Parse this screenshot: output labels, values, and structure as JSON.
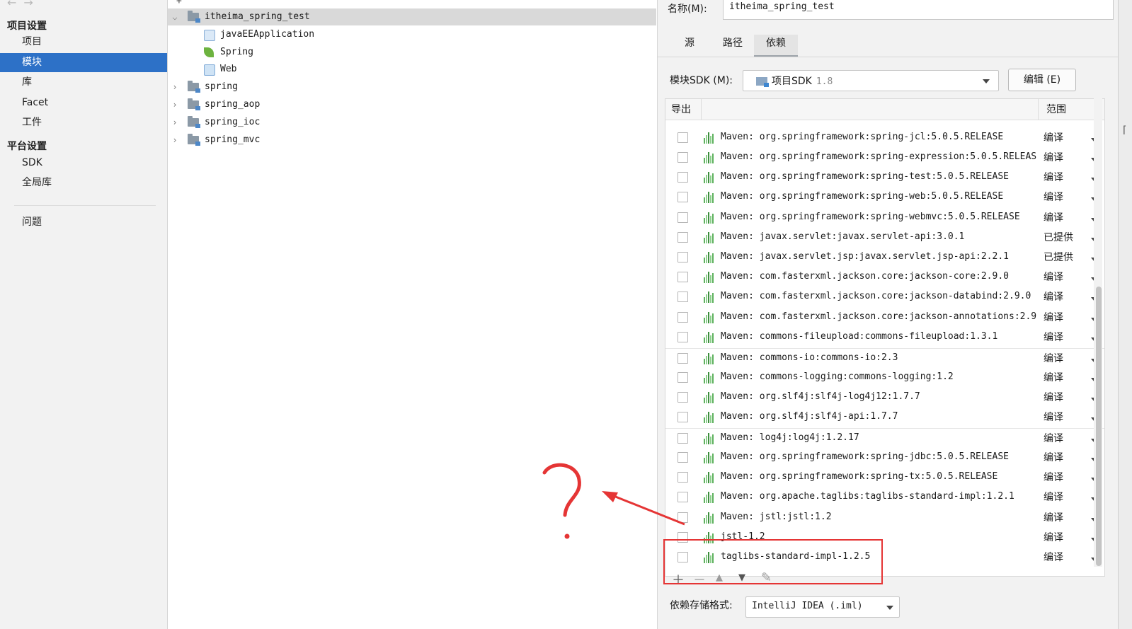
{
  "sidebar": {
    "project_settings_header": "项目设置",
    "items": [
      {
        "label": "项目"
      },
      {
        "label": "模块"
      },
      {
        "label": "库"
      },
      {
        "label": "Facet"
      },
      {
        "label": "工件"
      }
    ],
    "platform_settings_header": "平台设置",
    "platform_items": [
      {
        "label": "SDK"
      },
      {
        "label": "全局库"
      }
    ],
    "problems": "问题"
  },
  "tree": {
    "rows": [
      {
        "label": "itheima_spring_test"
      },
      {
        "label": "javaEEApplication"
      },
      {
        "label": "Spring"
      },
      {
        "label": "Web"
      },
      {
        "label": "spring"
      },
      {
        "label": "spring_aop"
      },
      {
        "label": "spring_ioc"
      },
      {
        "label": "spring_mvc"
      }
    ]
  },
  "module": {
    "name_label": "名称(M):",
    "name_value": "itheima_spring_test",
    "tabs": [
      {
        "label": "源"
      },
      {
        "label": "路径"
      },
      {
        "label": "依赖"
      }
    ],
    "sdk_label": "模块SDK (M):",
    "sdk_value": "项目SDK",
    "sdk_version": "1.8",
    "edit_button": "编辑 (E)",
    "table_header_export": "导出",
    "table_header_scope": "范围",
    "dependencies": [
      {
        "name": "Maven: org.springframework:spring-jcl:5.0.5.RELEASE",
        "scope": "编译"
      },
      {
        "name": "Maven: org.springframework:spring-expression:5.0.5.RELEAS",
        "scope": "编译"
      },
      {
        "name": "Maven: org.springframework:spring-test:5.0.5.RELEASE",
        "scope": "编译"
      },
      {
        "name": "Maven: org.springframework:spring-web:5.0.5.RELEASE",
        "scope": "编译"
      },
      {
        "name": "Maven: org.springframework:spring-webmvc:5.0.5.RELEASE",
        "scope": "编译"
      },
      {
        "name": "Maven: javax.servlet:javax.servlet-api:3.0.1",
        "scope": "已提供"
      },
      {
        "name": "Maven: javax.servlet.jsp:javax.servlet.jsp-api:2.2.1",
        "scope": "已提供"
      },
      {
        "name": "Maven: com.fasterxml.jackson.core:jackson-core:2.9.0",
        "scope": "编译"
      },
      {
        "name": "Maven: com.fasterxml.jackson.core:jackson-databind:2.9.0",
        "scope": "编译"
      },
      {
        "name": "Maven: com.fasterxml.jackson.core:jackson-annotations:2.9",
        "scope": "编译"
      },
      {
        "name": "Maven: commons-fileupload:commons-fileupload:1.3.1",
        "scope": "编译"
      },
      {
        "name": "Maven: commons-io:commons-io:2.3",
        "scope": "编译"
      },
      {
        "name": "Maven: commons-logging:commons-logging:1.2",
        "scope": "编译"
      },
      {
        "name": "Maven: org.slf4j:slf4j-log4j12:1.7.7",
        "scope": "编译"
      },
      {
        "name": "Maven: org.slf4j:slf4j-api:1.7.7",
        "scope": "编译"
      },
      {
        "name": "Maven: log4j:log4j:1.2.17",
        "scope": "编译"
      },
      {
        "name": "Maven: org.springframework:spring-jdbc:5.0.5.RELEASE",
        "scope": "编译"
      },
      {
        "name": "Maven: org.springframework:spring-tx:5.0.5.RELEASE",
        "scope": "编译"
      },
      {
        "name": "Maven: org.apache.taglibs:taglibs-standard-impl:1.2.1",
        "scope": "编译"
      },
      {
        "name": "Maven: jstl:jstl:1.2",
        "scope": "编译"
      },
      {
        "name": "jstl-1.2",
        "scope": "编译"
      },
      {
        "name": "taglibs-standard-impl-1.2.5",
        "scope": "编译"
      }
    ],
    "format_label": "依赖存储格式:",
    "format_value": "IntelliJ IDEA (.iml)"
  },
  "annotation": {
    "question_mark": "?"
  },
  "colors": {
    "selection_blue": "#2d71c7",
    "annotation_red": "#e53535",
    "library_icon_green": "#5fb25f"
  }
}
